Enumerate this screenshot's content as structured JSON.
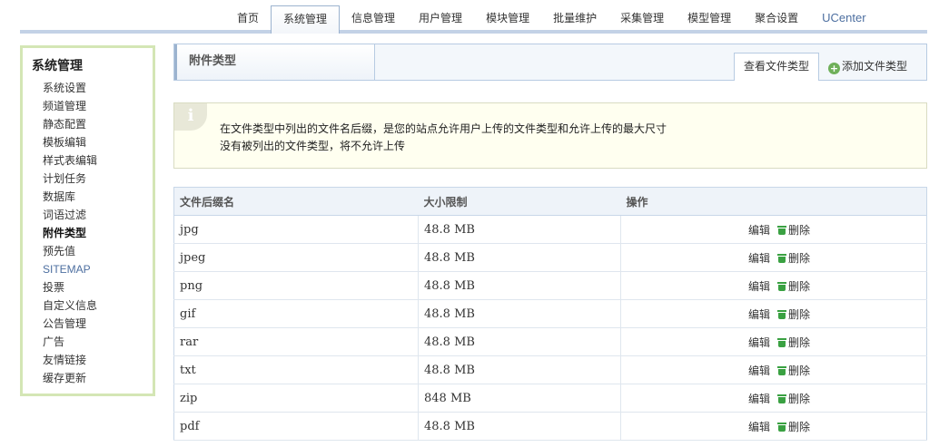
{
  "nav": {
    "tabs": [
      "首页",
      "系统管理",
      "信息管理",
      "用户管理",
      "模块管理",
      "批量维护",
      "采集管理",
      "模型管理",
      "聚合设置",
      "UCenter"
    ],
    "active_index": 1
  },
  "sidebar": {
    "title": "系统管理",
    "items": [
      "系统设置",
      "频道管理",
      "静态配置",
      "模板编辑",
      "样式表编辑",
      "计划任务",
      "数据库",
      "词语过滤",
      "附件类型",
      "预先值",
      "SITEMAP",
      "投票",
      "自定义信息",
      "公告管理",
      "广告",
      "友情链接",
      "缓存更新"
    ],
    "active_item": "附件类型"
  },
  "page": {
    "title": "附件类型",
    "view_button": "查看文件类型",
    "add_button": "添加文件类型"
  },
  "info": {
    "line1": "在文件类型中列出的文件名后缀，是您的站点允许用户上传的文件类型和允许上传的最大尺寸",
    "line2": "没有被列出的文件类型，将不允许上传"
  },
  "table": {
    "headers": [
      "文件后缀名",
      "大小限制",
      "操作"
    ],
    "edit_label": "编辑",
    "delete_label": "删除",
    "rows": [
      {
        "ext": "jpg",
        "size": "48.8 MB"
      },
      {
        "ext": "jpeg",
        "size": "48.8 MB"
      },
      {
        "ext": "png",
        "size": "48.8 MB"
      },
      {
        "ext": "gif",
        "size": "48.8 MB"
      },
      {
        "ext": "rar",
        "size": "48.8 MB"
      },
      {
        "ext": "txt",
        "size": "48.8 MB"
      },
      {
        "ext": "zip",
        "size": "848 MB"
      },
      {
        "ext": "pdf",
        "size": "48.8 MB"
      }
    ]
  }
}
